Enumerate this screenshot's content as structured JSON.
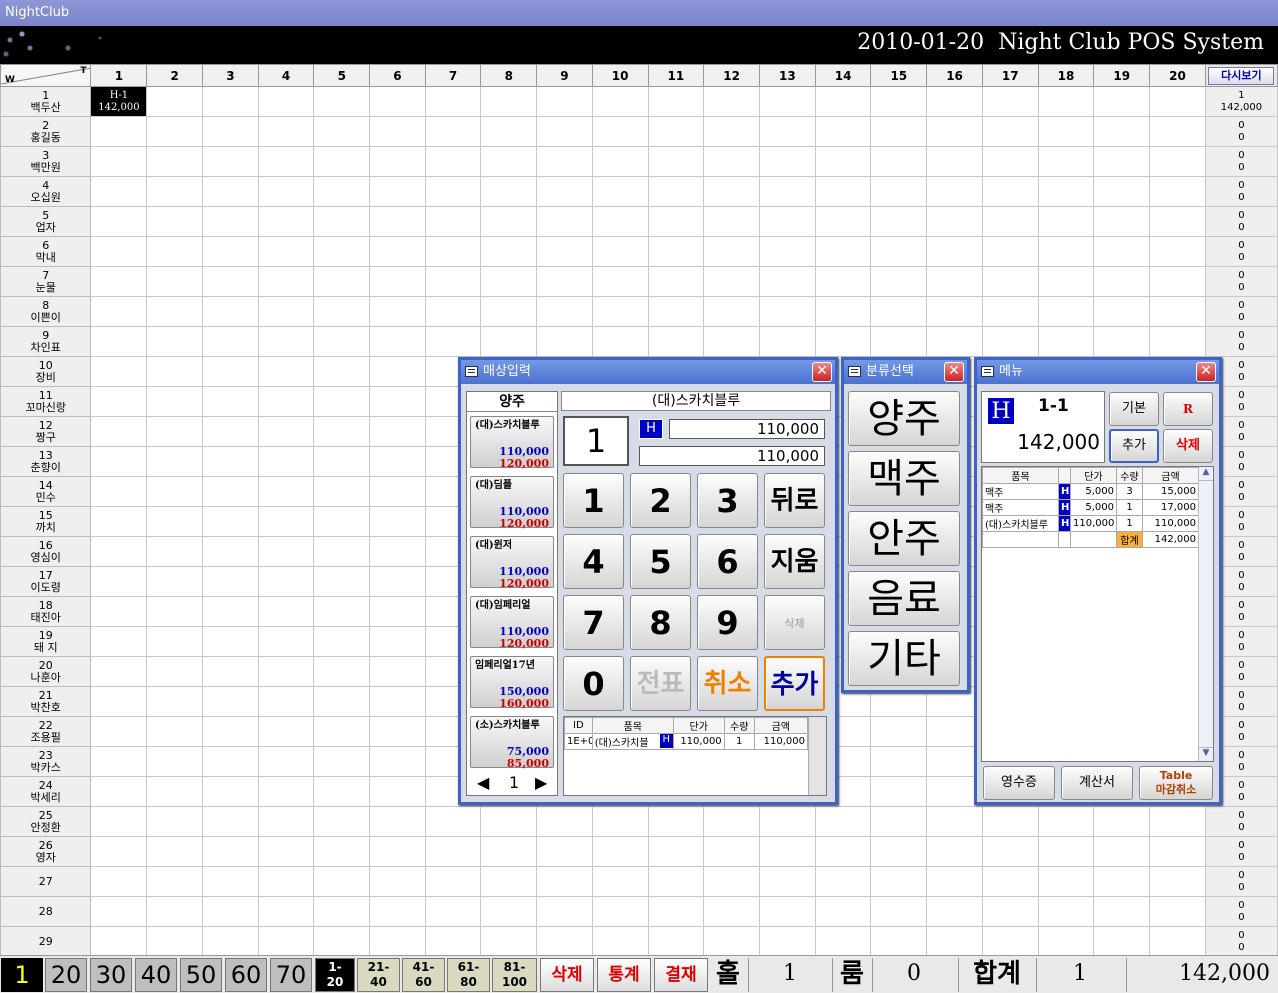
{
  "window": {
    "title": "NightClub"
  },
  "header": {
    "date": "2010-01-20",
    "system": "Night Club POS System"
  },
  "grid": {
    "corner_w": "W",
    "corner_t": "T",
    "reload_label": "다시보기",
    "columns": [
      "1",
      "2",
      "3",
      "4",
      "5",
      "6",
      "7",
      "8",
      "9",
      "10",
      "11",
      "12",
      "13",
      "14",
      "15",
      "16",
      "17",
      "18",
      "19",
      "20"
    ],
    "rows": [
      {
        "num": "1",
        "name": "백두산",
        "count": "1",
        "amount": "142,000"
      },
      {
        "num": "2",
        "name": "홍길동",
        "count": "0",
        "amount": "0"
      },
      {
        "num": "3",
        "name": "백만원",
        "count": "0",
        "amount": "0"
      },
      {
        "num": "4",
        "name": "오십원",
        "count": "0",
        "amount": "0"
      },
      {
        "num": "5",
        "name": "업자",
        "count": "0",
        "amount": "0"
      },
      {
        "num": "6",
        "name": "막내",
        "count": "0",
        "amount": "0"
      },
      {
        "num": "7",
        "name": "눈물",
        "count": "0",
        "amount": "0"
      },
      {
        "num": "8",
        "name": "이쁜이",
        "count": "0",
        "amount": "0"
      },
      {
        "num": "9",
        "name": "차인표",
        "count": "0",
        "amount": "0"
      },
      {
        "num": "10",
        "name": "장비",
        "count": "0",
        "amount": "0"
      },
      {
        "num": "11",
        "name": "꼬마신랑",
        "count": "0",
        "amount": "0"
      },
      {
        "num": "12",
        "name": "짱구",
        "count": "0",
        "amount": "0"
      },
      {
        "num": "13",
        "name": "춘향이",
        "count": "0",
        "amount": "0"
      },
      {
        "num": "14",
        "name": "민수",
        "count": "0",
        "amount": "0"
      },
      {
        "num": "15",
        "name": "까치",
        "count": "0",
        "amount": "0"
      },
      {
        "num": "16",
        "name": "영심이",
        "count": "0",
        "amount": "0"
      },
      {
        "num": "17",
        "name": "이도령",
        "count": "0",
        "amount": "0"
      },
      {
        "num": "18",
        "name": "태진아",
        "count": "0",
        "amount": "0"
      },
      {
        "num": "19",
        "name": "돼 지",
        "count": "0",
        "amount": "0"
      },
      {
        "num": "20",
        "name": "나훈아",
        "count": "0",
        "amount": "0"
      },
      {
        "num": "21",
        "name": "박찬호",
        "count": "0",
        "amount": "0"
      },
      {
        "num": "22",
        "name": "조용필",
        "count": "0",
        "amount": "0"
      },
      {
        "num": "23",
        "name": "박카스",
        "count": "0",
        "amount": "0"
      },
      {
        "num": "24",
        "name": "박세리",
        "count": "0",
        "amount": "0"
      },
      {
        "num": "25",
        "name": "안정환",
        "count": "0",
        "amount": "0"
      },
      {
        "num": "26",
        "name": "영자",
        "count": "0",
        "amount": "0"
      },
      {
        "num": "27",
        "name": "",
        "count": "0",
        "amount": "0"
      },
      {
        "num": "28",
        "name": "",
        "count": "0",
        "amount": "0"
      },
      {
        "num": "29",
        "name": "",
        "count": "0",
        "amount": "0"
      }
    ],
    "occupied": {
      "row": 0,
      "col": 0,
      "label": "H-1",
      "amount": "142,000"
    }
  },
  "sales": {
    "title": "매상입력",
    "category": "양주",
    "products": [
      {
        "name": "(대)스카치블루",
        "price1": "110,000",
        "price2": "120,000"
      },
      {
        "name": "(대)딤플",
        "price1": "110,000",
        "price2": "120,000"
      },
      {
        "name": "(대)윈저",
        "price1": "110,000",
        "price2": "120,000"
      },
      {
        "name": "(대)임페리얼",
        "price1": "110,000",
        "price2": "120,000"
      },
      {
        "name": "임페리얼17년",
        "price1": "150,000",
        "price2": "160,000"
      },
      {
        "name": "(소)스카치블루",
        "price1": "75,000",
        "price2": "85,000"
      }
    ],
    "page": "1",
    "selected_item": "(대)스카치블루",
    "qty": "1",
    "mode_badge": "H",
    "unit_price": "110,000",
    "total_price": "110,000",
    "keys": {
      "k1": "1",
      "k2": "2",
      "k3": "3",
      "back": "뒤로",
      "k4": "4",
      "k5": "5",
      "k6": "6",
      "clear": "지움",
      "k7": "7",
      "k8": "8",
      "k9": "9",
      "del": "삭제",
      "k0": "0",
      "slip": "전표",
      "cancel": "취소",
      "add": "추가"
    },
    "list_headers": [
      "ID",
      "품목",
      "단가",
      "수량",
      "금액"
    ],
    "list_rows": [
      {
        "id": "1E+0",
        "item": "(대)스카치블",
        "h": "H",
        "price": "110,000",
        "qty": "1",
        "amount": "110,000"
      }
    ]
  },
  "category_win": {
    "title": "분류선택",
    "items": [
      "양주",
      "맥주",
      "안주",
      "음료",
      "기타"
    ]
  },
  "menu_win": {
    "title": "메뉴",
    "badge": "H",
    "table_no": "1-1",
    "amount": "142,000",
    "btn_basic": "기본",
    "btn_r": "R",
    "btn_add": "추가",
    "btn_delete": "삭제",
    "headers": [
      "품목",
      "",
      "단가",
      "수량",
      "금액"
    ],
    "rows": [
      {
        "item": "맥주",
        "h": "H",
        "price": "5,000",
        "qty": "3",
        "amount": "15,000"
      },
      {
        "item": "맥주",
        "h": "H",
        "price": "5,000",
        "qty": "1",
        "amount": "17,000"
      },
      {
        "item": "(대)스카치블루",
        "h": "H",
        "price": "110,000",
        "qty": "1",
        "amount": "110,000"
      }
    ],
    "sum_label": "합계",
    "sum_amount": "142,000",
    "btn_receipt": "영수증",
    "btn_bill": "계산서",
    "btn_table_line1": "Table",
    "btn_table_line2": "마감취소"
  },
  "bottom": {
    "pages": [
      "1",
      "20",
      "30",
      "40",
      "50",
      "60",
      "70"
    ],
    "ranges": [
      {
        "a": "1-",
        "b": "20"
      },
      {
        "a": "21-",
        "b": "40"
      },
      {
        "a": "41-",
        "b": "60"
      },
      {
        "a": "61-",
        "b": "80"
      },
      {
        "a": "81-",
        "b": "100"
      }
    ],
    "delete": "삭제",
    "stats": "통계",
    "settle": "결재",
    "hall_label": "홀",
    "hall_value": "1",
    "room_label": "룸",
    "room_value": "0",
    "total_label": "합계",
    "total_count": "1",
    "total_amount": "142,000"
  },
  "colors": {
    "window_border": "#3c64c8",
    "price_blue": "#0000c0",
    "price_red": "#d00000",
    "accent_orange": "#f08000"
  }
}
